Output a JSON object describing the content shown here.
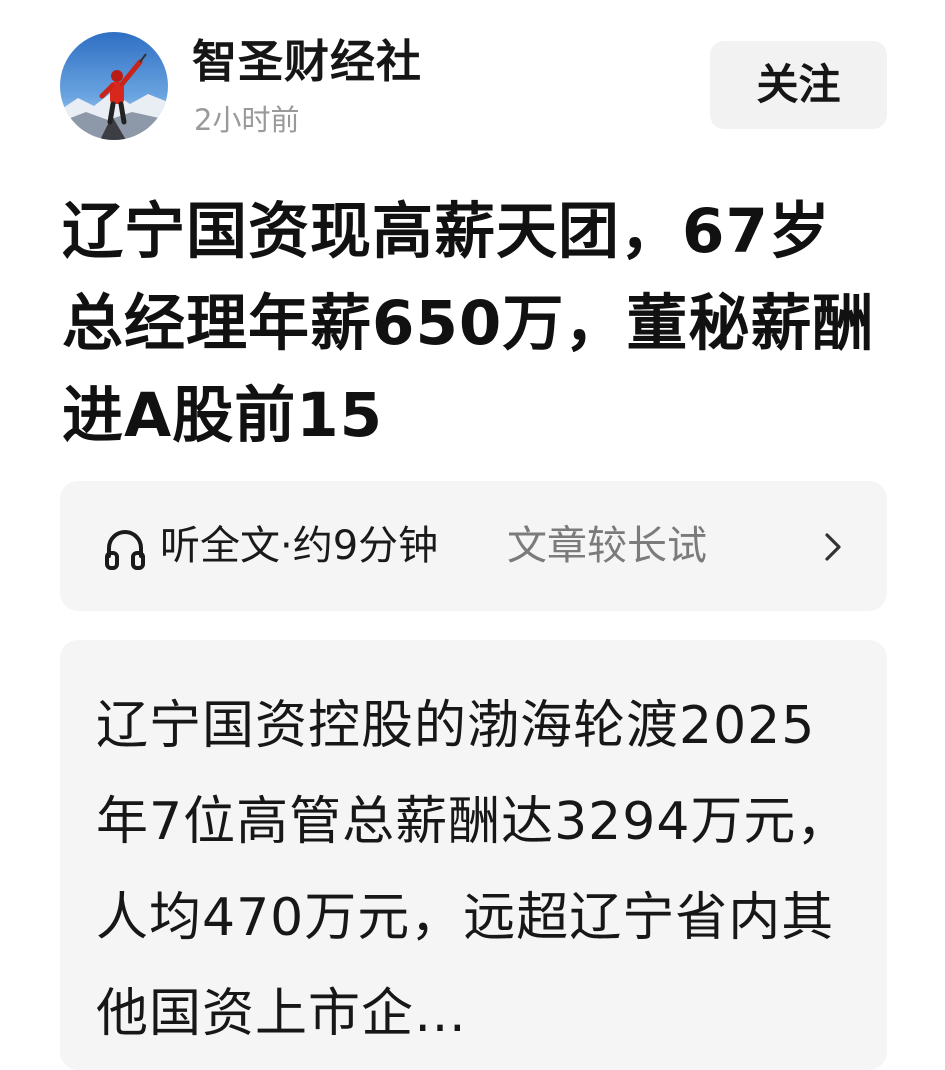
{
  "header": {
    "author_name": "智圣财经社",
    "post_time": "2小时前",
    "follow_label": "关注",
    "avatar_icon": "avatar-mountain-climber-icon"
  },
  "title": "辽宁国资现高薪天团，67岁总经理年薪650万，董秘薪酬进A股前15",
  "listen": {
    "icon": "headphones-icon",
    "label": "听全文·约9分钟",
    "preview": "文章较长试",
    "chevron_icon": "chevron-right-icon"
  },
  "summary": {
    "text": "辽宁国资控股的渤海轮渡2025年7位高管总薪酬达3294万元，人均470万元，远超辽宁省内其他国资上市企…"
  },
  "colors": {
    "background": "#ffffff",
    "card_background": "#f5f5f5",
    "follow_button_background": "#f2f2f2",
    "muted_text": "#9a9a9a",
    "preview_text": "#7b7b7b"
  }
}
